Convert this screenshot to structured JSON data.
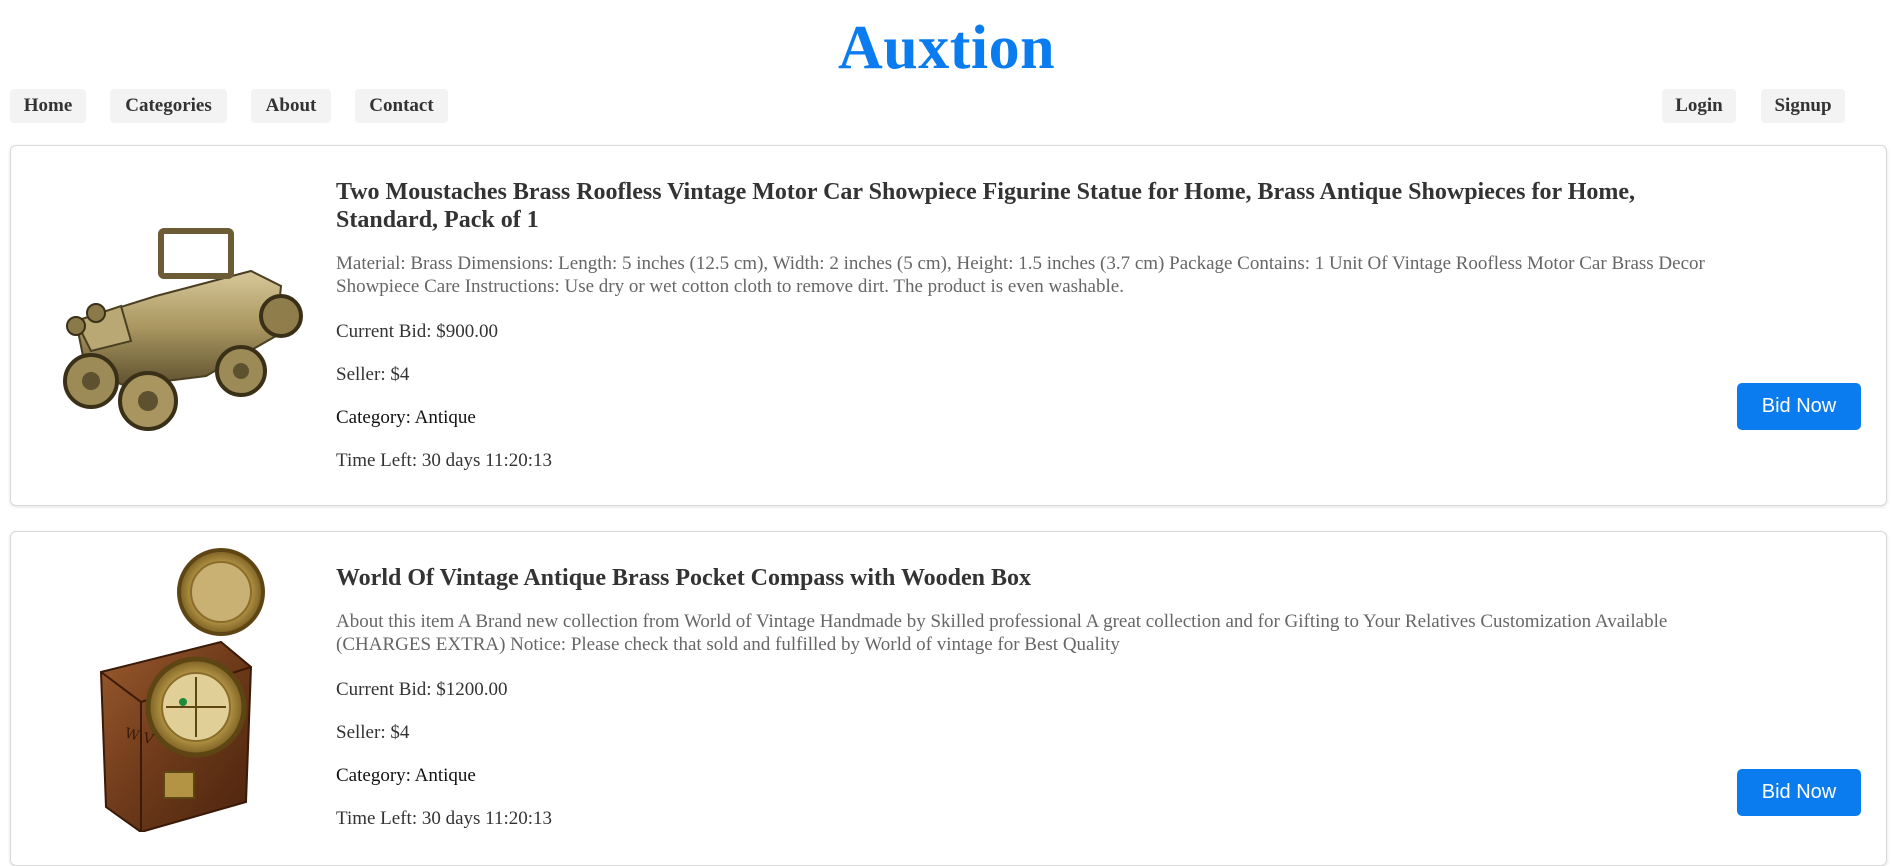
{
  "site": {
    "title": "Auxtion"
  },
  "nav": {
    "home": "Home",
    "categories": "Categories",
    "about": "About",
    "contact": "Contact",
    "login": "Login",
    "signup": "Signup"
  },
  "colors": {
    "accent": "#0a7cf0",
    "nav_bg": "#f3f3f3",
    "card_border": "#d9d9d9"
  },
  "listings": [
    {
      "image_icon": "brass-vintage-car-image",
      "title": "Two Moustaches Brass Roofless Vintage Motor Car Showpiece Figurine Statue for Home, Brass Antique Showpieces for Home, Standard, Pack of 1",
      "description": "Material: Brass Dimensions: Length: 5 inches (12.5 cm), Width: 2 inches (5 cm), Height: 1.5 inches (3.7 cm) Package Contains: 1 Unit Of Vintage Roofless Motor Car Brass Decor Showpiece Care Instructions: Use dry or wet cotton cloth to remove dirt. The product is even washable.",
      "current_bid": "Current Bid: $900.00",
      "seller": "Seller: $4",
      "category": "Category: Antique",
      "time_left": "Time Left: 30 days 11:20:13",
      "bid_label": "Bid Now"
    },
    {
      "image_icon": "brass-compass-box-image",
      "title": "World Of Vintage Antique Brass Pocket Compass with Wooden Box",
      "description": "About this item A Brand new collection from World of Vintage Handmade by Skilled professional A great collection and for Gifting to Your Relatives Customization Available (CHARGES EXTRA) Notice: Please check that sold and fulfilled by World of vintage for Best Quality",
      "current_bid": "Current Bid: $1200.00",
      "seller": "Seller: $4",
      "category": "Category: Antique",
      "time_left": "Time Left: 30 days 11:20:13",
      "bid_label": "Bid Now"
    }
  ]
}
